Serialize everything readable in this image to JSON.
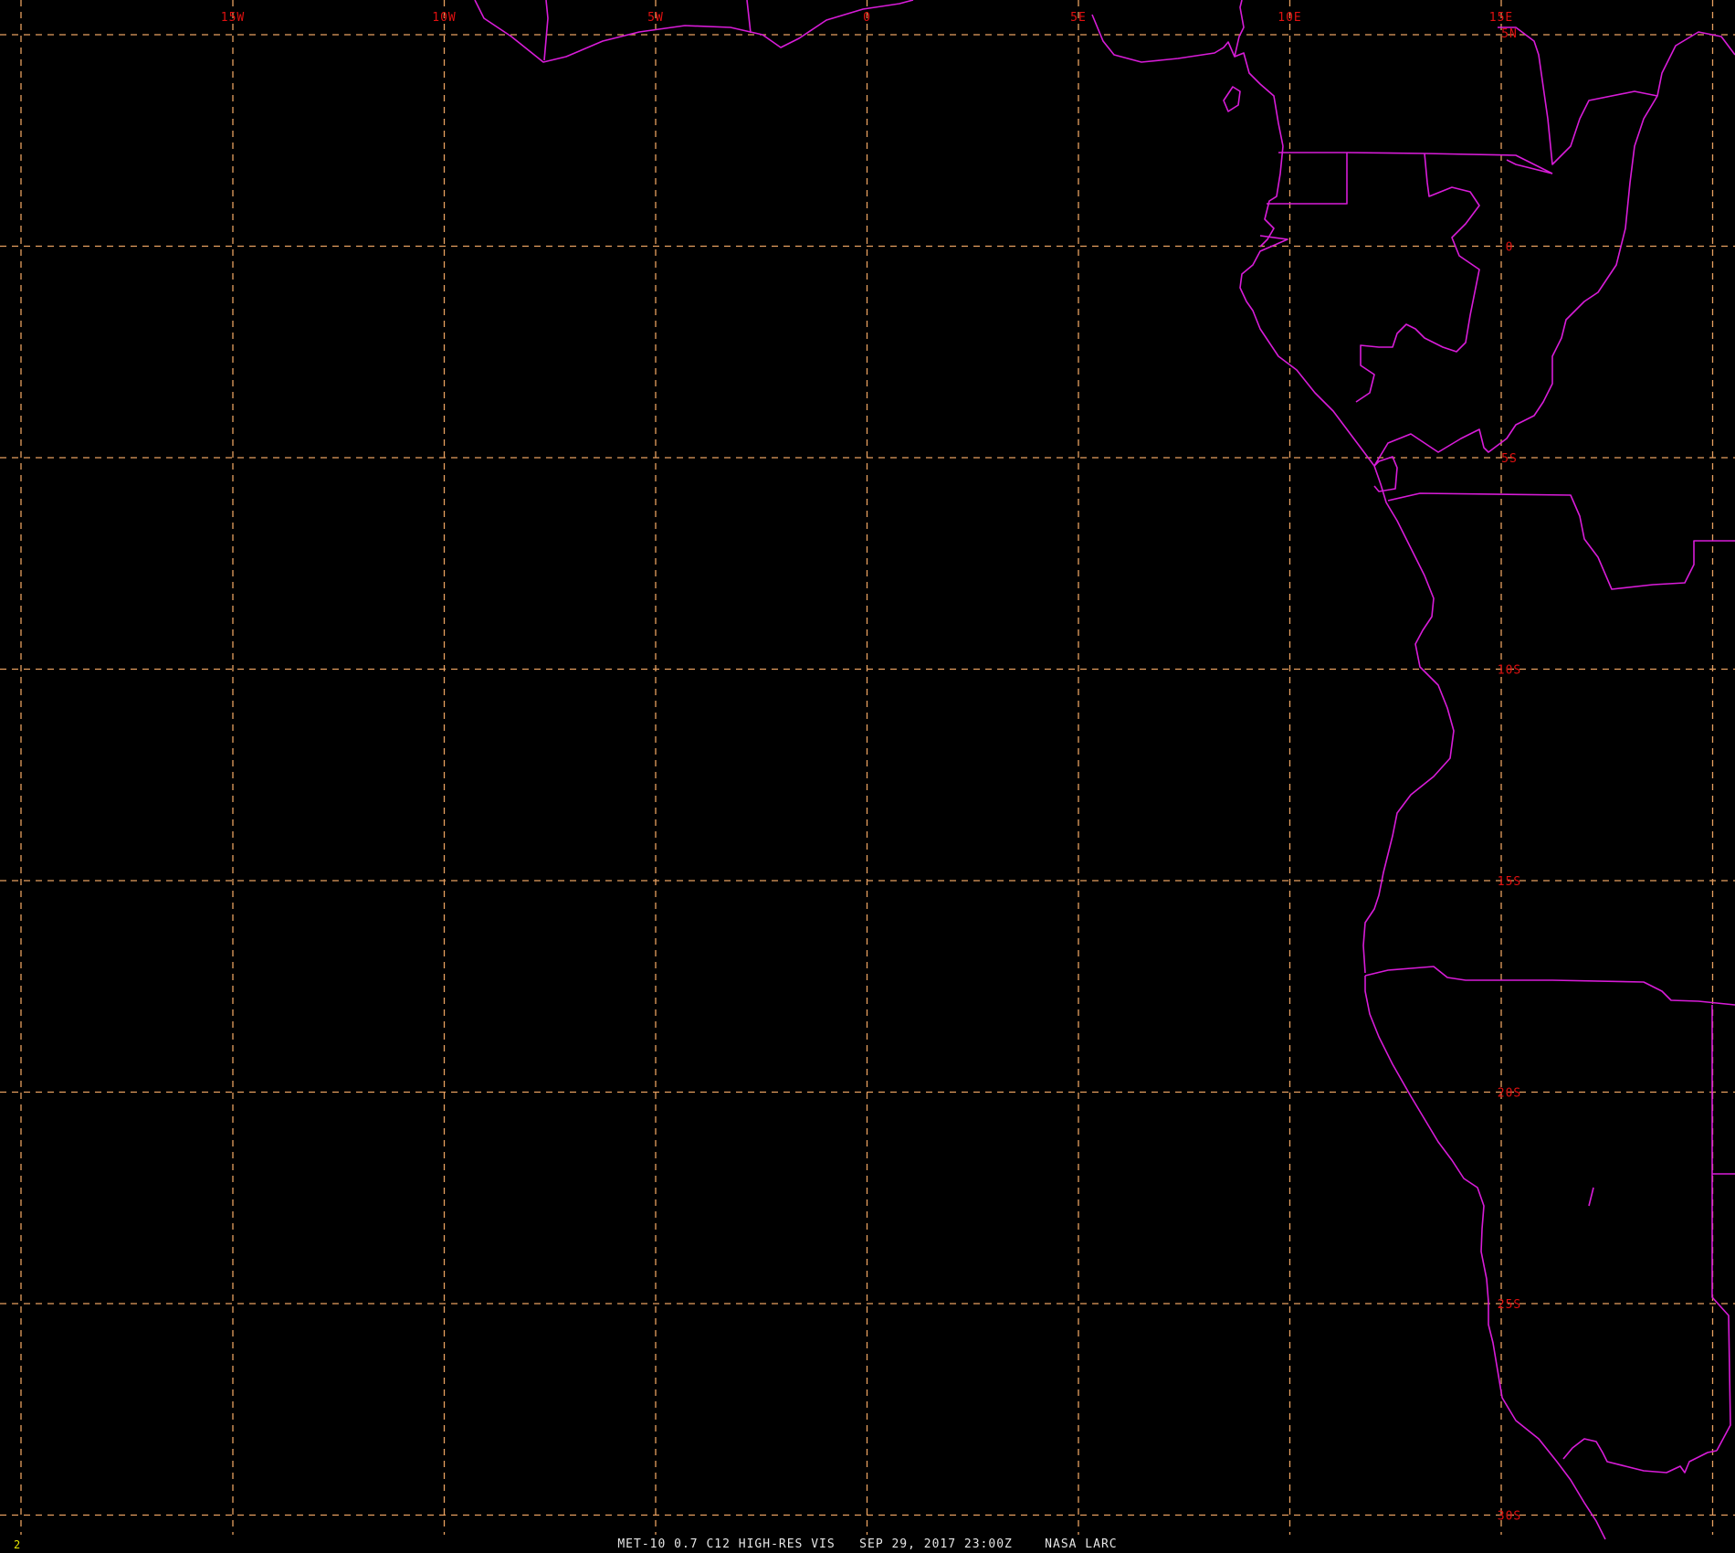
{
  "image": {
    "caption": "MET-10 0.7 C12 HIGH-RES VIS   SEP 29, 2017 23:00Z    NASA LARC",
    "frame_number": "2"
  },
  "map": {
    "longitude_labels": [
      "15W",
      "10W",
      "5W",
      "0",
      "5E",
      "10E",
      "15E"
    ],
    "latitude_labels": [
      "5N",
      "0",
      "5S",
      "10S",
      "15S",
      "20S",
      "25S",
      "30S"
    ],
    "grid_line_style": "dashed",
    "colors": {
      "background": "#000000",
      "grid": "#e8a060",
      "grid_labels": "#e01010",
      "boundaries": "#d81cd8",
      "caption": "#e6e6e6",
      "frame_number": "#e6e600"
    }
  }
}
